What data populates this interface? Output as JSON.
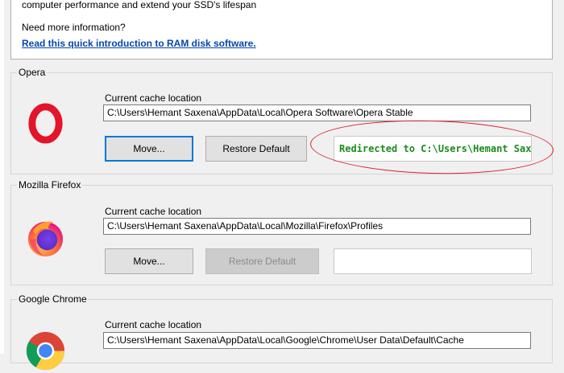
{
  "intro": {
    "line1": "computer performance and extend your SSD's lifespan",
    "line2": "Need more information?",
    "link": "Read this quick introduction to RAM disk software."
  },
  "browsers": [
    {
      "title": "Opera",
      "icon": "opera-logo-icon",
      "cache_label": "Current cache location",
      "path": "C:\\Users\\Hemant Saxena\\AppData\\Local\\Opera Software\\Opera Stable",
      "move_label": "Move...",
      "restore_label": "Restore Default",
      "status": "Redirected to C:\\Users\\Hemant Saxena\\I"
    },
    {
      "title": "Mozilla Firefox",
      "icon": "firefox-logo-icon",
      "cache_label": "Current cache location",
      "path": "C:\\Users\\Hemant Saxena\\AppData\\Local\\Mozilla\\Firefox\\Profiles",
      "move_label": "Move...",
      "restore_label": "Restore Default",
      "status": ""
    },
    {
      "title": "Google Chrome",
      "icon": "chrome-logo-icon",
      "cache_label": "Current cache location",
      "path": "C:\\Users\\Hemant Saxena\\AppData\\Local\\Google\\Chrome\\User Data\\Default\\Cache"
    }
  ],
  "colors": {
    "status_text": "#1a8c1a",
    "link": "#0645ad",
    "annotation": "#d9232e",
    "focus": "#0078d7"
  }
}
